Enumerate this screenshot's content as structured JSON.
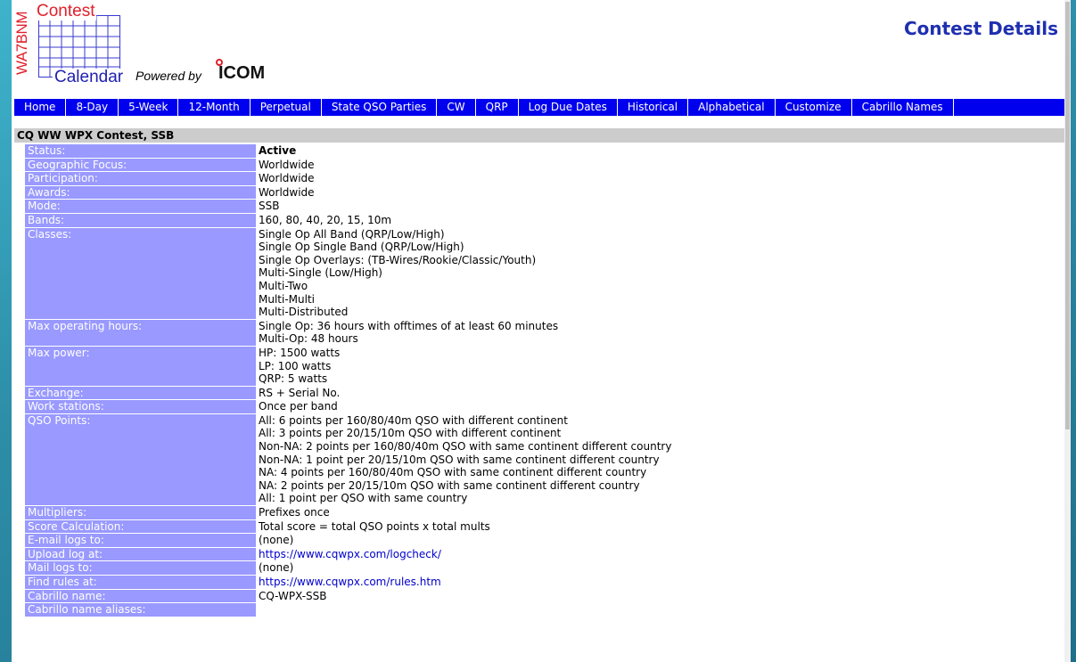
{
  "logo": {
    "vertical": "WA7BNM",
    "top": "Contest",
    "bottom": "Calendar"
  },
  "powered_by": "Powered by",
  "sponsor": "ICOM",
  "page_title": "Contest Details",
  "nav": [
    "Home",
    "8-Day",
    "5-Week",
    "12-Month",
    "Perpetual",
    "State QSO Parties",
    "CW",
    "QRP",
    "Log Due Dates",
    "Historical",
    "Alphabetical",
    "Customize",
    "Cabrillo Names"
  ],
  "contest_name": "CQ WW WPX Contest, SSB",
  "rows": [
    {
      "label": "Status:",
      "value": "Active",
      "bold": true
    },
    {
      "label": "Geographic Focus:",
      "value": "Worldwide"
    },
    {
      "label": "Participation:",
      "value": "Worldwide"
    },
    {
      "label": "Awards:",
      "value": "Worldwide"
    },
    {
      "label": "Mode:",
      "value": "SSB"
    },
    {
      "label": "Bands:",
      "value": "160, 80, 40, 20, 15, 10m"
    },
    {
      "label": "Classes:",
      "value": "Single Op All Band (QRP/Low/High)\nSingle Op Single Band (QRP/Low/High)\nSingle Op Overlays: (TB-Wires/Rookie/Classic/Youth)\nMulti-Single (Low/High)\nMulti-Two\nMulti-Multi\nMulti-Distributed"
    },
    {
      "label": "Max operating hours:",
      "value": "Single Op: 36 hours with offtimes of at least 60 minutes\nMulti-Op: 48 hours"
    },
    {
      "label": "Max power:",
      "value": "HP: 1500 watts\nLP: 100 watts\nQRP: 5 watts"
    },
    {
      "label": "Exchange:",
      "value": "RS + Serial No."
    },
    {
      "label": "Work stations:",
      "value": "Once per band"
    },
    {
      "label": "QSO Points:",
      "value": "All: 6 points per 160/80/40m QSO with different continent\nAll: 3 points per 20/15/10m QSO with different continent\nNon-NA: 2 points per 160/80/40m QSO with same continent different country\nNon-NA: 1 point per 20/15/10m QSO with same continent different country\nNA: 4 points per 160/80/40m QSO with same continent different country\nNA: 2 points per 20/15/10m QSO with same continent different country\nAll: 1 point per QSO with same country"
    },
    {
      "label": "Multipliers:",
      "value": "Prefixes once"
    },
    {
      "label": "Score Calculation:",
      "value": "Total score = total QSO points x total mults"
    },
    {
      "label": "E-mail logs to:",
      "value": "(none)"
    },
    {
      "label": "Upload log at:",
      "value": "https://www.cqwpx.com/logcheck/",
      "link": true
    },
    {
      "label": "Mail logs to:",
      "value": "(none)"
    },
    {
      "label": "Find rules at:",
      "value": "https://www.cqwpx.com/rules.htm",
      "link": true
    },
    {
      "label": "Cabrillo name:",
      "value": "CQ-WPX-SSB"
    },
    {
      "label": "Cabrillo name aliases:",
      "value": ""
    }
  ]
}
